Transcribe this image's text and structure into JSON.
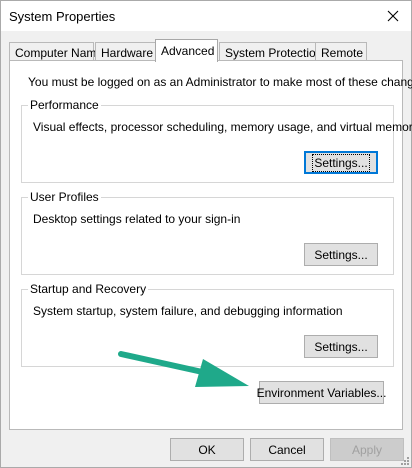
{
  "window": {
    "title": "System Properties",
    "close_icon": "close-icon"
  },
  "tabs": [
    {
      "label": "Computer Name",
      "active": false
    },
    {
      "label": "Hardware",
      "active": false
    },
    {
      "label": "Advanced",
      "active": true
    },
    {
      "label": "System Protection",
      "active": false
    },
    {
      "label": "Remote",
      "active": false
    }
  ],
  "advanced": {
    "admin_note": "You must be logged on as an Administrator to make most of these changes.",
    "performance": {
      "title": "Performance",
      "description": "Visual effects, processor scheduling, memory usage, and virtual memory",
      "settings_label": "Settings..."
    },
    "user_profiles": {
      "title": "User Profiles",
      "description": "Desktop settings related to your sign-in",
      "settings_label": "Settings..."
    },
    "startup_recovery": {
      "title": "Startup and Recovery",
      "description": "System startup, system failure, and debugging information",
      "settings_label": "Settings..."
    },
    "env_vars_label": "Environment Variables..."
  },
  "footer": {
    "ok_label": "OK",
    "cancel_label": "Cancel",
    "apply_label": "Apply"
  },
  "annotation": {
    "arrow_color": "#1fa98a",
    "arrow_icon": "pointer-arrow-icon"
  }
}
